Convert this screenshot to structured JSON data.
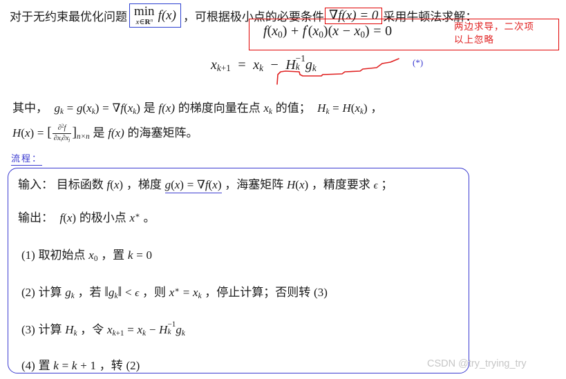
{
  "document": {
    "type": "math-lecture-note",
    "language": "zh-CN",
    "title_line": "对于无约束最优化问题 min f(x)，可根据极小点的必要条件 ∇f(x)=0 采用牛顿法求解："
  },
  "line1": {
    "prefix": "对于无约束最优化问题",
    "boxed_min": {
      "op": "min",
      "subscript_var": "x",
      "subscript_set": "R",
      "subscript_dim": "n",
      "body": "f(x)"
    },
    "after_box": "，可根据极小点的必要条件",
    "boxed_grad": "∇f(x) = 0",
    "suffix": "采用牛顿法求解："
  },
  "taylor_equation": {
    "text": "f(x₀) + f′(x₀)(x − x₀) = 0",
    "f0": "f",
    "x0": "x",
    "sub0": "0"
  },
  "red_annotation": {
    "line1": "两边求导，二次项",
    "line2": "以上忽略",
    "color": "#e02020"
  },
  "newton_iteration": {
    "text": "x_{k+1} = x_k − H_k^{-1} g_k",
    "star_mark": "(*)",
    "star_color": "#3a3ad0"
  },
  "explanation": {
    "line1_parts": {
      "a": "其中，",
      "b": "g_k = g(x_k) = ∇f(x_k)",
      "c": "是",
      "d": "f(x)",
      "e": "的梯度向量在点",
      "f": "x_k",
      "g": "的值；",
      "h": "H_k = H(x_k)",
      "i": "，"
    },
    "line2_parts": {
      "a": "H(x) = [ ∂²f / ∂x_i∂x_j ]_{n×n}",
      "b": "是",
      "c": "f(x)",
      "d": "的海塞矩阵。"
    }
  },
  "flow_label": {
    "text": "流程：",
    "color": "#3a3ad0"
  },
  "algorithm": {
    "input": {
      "label": "输入：",
      "p1": "目标函数",
      "f": "f(x)",
      "p2": "，梯度",
      "grad": "g(x) = ∇f(x)",
      "p3": "，海塞矩阵",
      "H": "H(x)",
      "p4": "，精度要求",
      "eps": "ε",
      "p5": "；"
    },
    "output": {
      "label": "输出：",
      "p1": "f(x)",
      "p2": "的极小点",
      "p3": "x*",
      "p4": "。"
    },
    "steps": [
      {
        "num": "(1)",
        "text": "取初始点 x₀ ，置 k = 0"
      },
      {
        "num": "(2)",
        "text": "计算 g_k ，若 ||g_k|| < ε ，则 x* = x_k ，停止计算；否则转 (3)"
      },
      {
        "num": "(3)",
        "text": "计算 H_k ，令 x_{k+1} = x_k − H_k^{-1} g_k"
      },
      {
        "num": "(4)",
        "text": "置 k = k + 1 ，转 (2)"
      }
    ],
    "border_color": "#3a3ad0"
  },
  "watermark": {
    "text": "CSDN @try_trying_try",
    "color": "#c6c6c6"
  }
}
